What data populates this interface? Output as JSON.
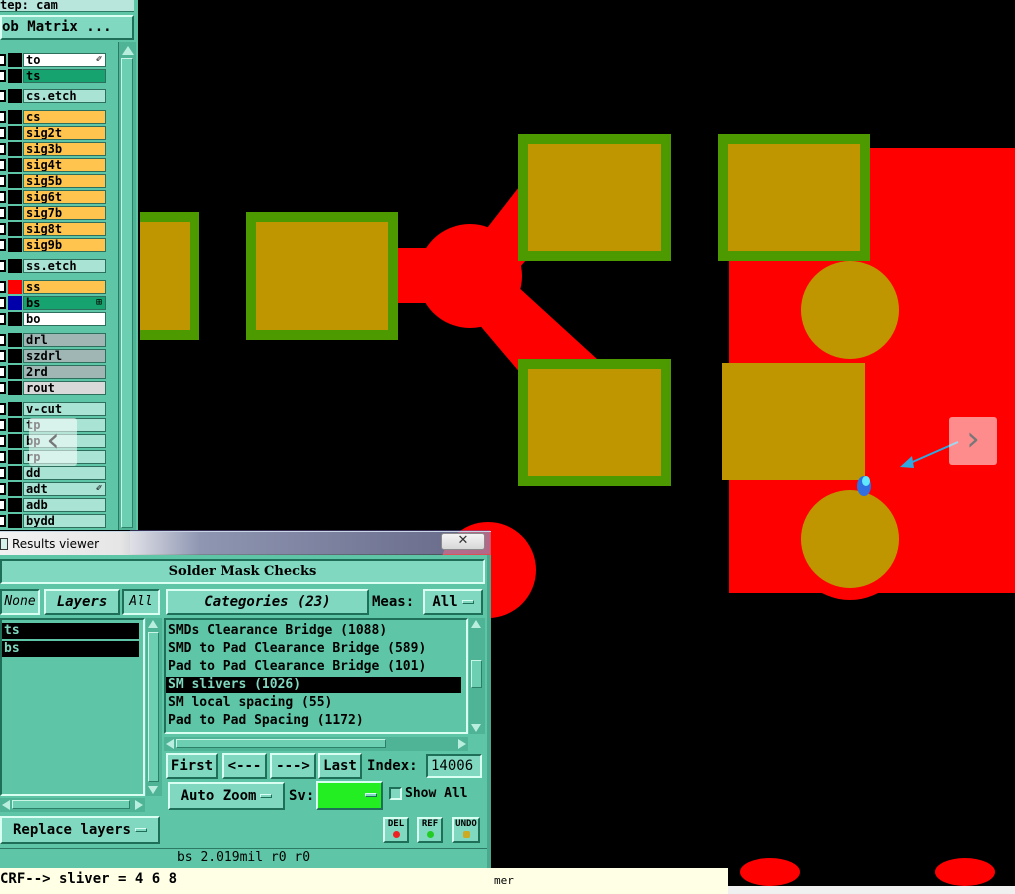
{
  "step_label": "tep: cam",
  "job_matrix_button": "ob Matrix ...",
  "layers": [
    {
      "name": "to",
      "color": "#ffffff",
      "swatch": "#000000",
      "mark": "✐"
    },
    {
      "name": "ts",
      "color": "#17a36f",
      "swatch": "#000000",
      "mark": ""
    },
    {
      "name": "cs.etch",
      "color": "#a9e3d4",
      "swatch": "#000000",
      "mark": ""
    },
    {
      "name": "cs",
      "color": "#ffc44d",
      "swatch": "#000000",
      "mark": ""
    },
    {
      "name": "sig2t",
      "color": "#ffc44d",
      "swatch": "#000000",
      "mark": ""
    },
    {
      "name": "sig3b",
      "color": "#ffc44d",
      "swatch": "#000000",
      "mark": ""
    },
    {
      "name": "sig4t",
      "color": "#ffc44d",
      "swatch": "#000000",
      "mark": ""
    },
    {
      "name": "sig5b",
      "color": "#ffc44d",
      "swatch": "#000000",
      "mark": ""
    },
    {
      "name": "sig6t",
      "color": "#ffc44d",
      "swatch": "#000000",
      "mark": ""
    },
    {
      "name": "sig7b",
      "color": "#ffc44d",
      "swatch": "#000000",
      "mark": ""
    },
    {
      "name": "sig8t",
      "color": "#ffc44d",
      "swatch": "#000000",
      "mark": ""
    },
    {
      "name": "sig9b",
      "color": "#ffc44d",
      "swatch": "#000000",
      "mark": ""
    },
    {
      "name": "ss.etch",
      "color": "#a9e3d4",
      "swatch": "#000000",
      "mark": ""
    },
    {
      "name": "ss",
      "color": "#ffc44d",
      "swatch": "#ff0000",
      "mark": ""
    },
    {
      "name": "bs",
      "color": "#17a36f",
      "swatch": "#0000aa",
      "mark": "⊞"
    },
    {
      "name": "bo",
      "color": "#ffffff",
      "swatch": "#000000",
      "mark": ""
    },
    {
      "name": "drl",
      "color": "#9fb6b4",
      "swatch": "#000000",
      "mark": ""
    },
    {
      "name": "szdrl",
      "color": "#9fb6b4",
      "swatch": "#000000",
      "mark": ""
    },
    {
      "name": "2rd",
      "color": "#9fb6b4",
      "swatch": "#000000",
      "mark": ""
    },
    {
      "name": "rout",
      "color": "#d9d9d9",
      "swatch": "#000000",
      "mark": ""
    },
    {
      "name": "v-cut",
      "color": "#a9e3d4",
      "swatch": "#000000",
      "mark": ""
    },
    {
      "name": "tp",
      "color": "#a9e3d4",
      "swatch": "#000000",
      "mark": ""
    },
    {
      "name": "bp",
      "color": "#a9e3d4",
      "swatch": "#000000",
      "mark": ""
    },
    {
      "name": "rp",
      "color": "#a9e3d4",
      "swatch": "#000000",
      "mark": ""
    },
    {
      "name": "dd",
      "color": "#a9e3d4",
      "swatch": "#000000",
      "mark": ""
    },
    {
      "name": "adt",
      "color": "#a9e3d4",
      "swatch": "#000000",
      "mark": "✐"
    },
    {
      "name": "adb",
      "color": "#a9e3d4",
      "swatch": "#000000",
      "mark": ""
    },
    {
      "name": "bydd",
      "color": "#a9e3d4",
      "swatch": "#000000",
      "mark": ""
    }
  ],
  "nav": {
    "prev": "‹",
    "next": "›"
  },
  "results_viewer": {
    "window_title": "Results viewer",
    "close_glyph": "✕",
    "header": "Solder Mask Checks",
    "none_button": "None",
    "layers_button": "Layers",
    "all_button": "All",
    "categories_button": "Categories (23)",
    "meas_label": "Meas:",
    "meas_value": "All",
    "layer_items": [
      "ts",
      "bs"
    ],
    "category_items": [
      "SMDs Clearance Bridge (1088)",
      "SMD to Pad Clearance Bridge (589)",
      "Pad to Pad Clearance Bridge (101)",
      "SM slivers (1026)",
      "SM local spacing (55)",
      "Pad to Pad Spacing (1172)"
    ],
    "selected_category": 3,
    "first_button": "First",
    "prev_button": "<---",
    "next_button": "--->",
    "last_button": "Last",
    "index_label": "Index:",
    "index_value": "14006",
    "auto_zoom": "Auto Zoom",
    "sv_label": "Sv:",
    "sv_color": "#22ee22",
    "show_all": "Show All",
    "replace_layers": "Replace layers",
    "icon_del": "DEL",
    "icon_ref": "REF",
    "icon_undo": "UNDO"
  },
  "status_text": "bs 2.019mil  r0  r0",
  "message_text": "CRF--> sliver = 4 6 8",
  "message_tail": "mer",
  "colors": {
    "copper": "#ff0000",
    "pad_fill": "#bf9600",
    "pad_outline": "#4c9900",
    "panel": "#5ec6a6",
    "arrow": "#2fa8e0"
  }
}
